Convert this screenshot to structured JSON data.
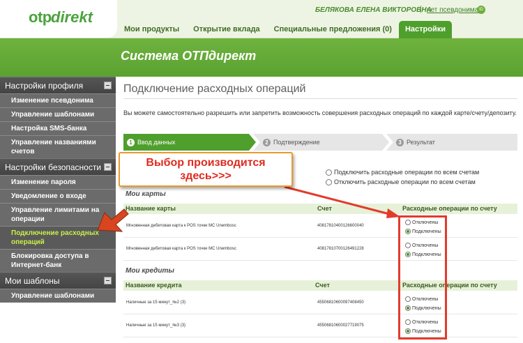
{
  "header": {
    "logo_otp": "otp",
    "logo_direkt": "direkt",
    "username": "БЕЛЯКОВА ЕЛЕНА ВИКТОРОВНА",
    "separator": "|",
    "alias_link": "нет псевдонима",
    "alias_icon": "ID"
  },
  "nav": {
    "tabs": [
      "Мои продукты",
      "Открытие вклада",
      "Специальные предложения (0)",
      "Настройки"
    ]
  },
  "banner": {
    "title": "Система ОТПдирект"
  },
  "sidebar": {
    "sections": [
      {
        "title": "Настройки профиля",
        "items": [
          "Изменение псевдонима",
          "Управление шаблонами",
          "Настройка SMS-банка",
          "Управление названиями счетов"
        ]
      },
      {
        "title": "Настройки безопасности",
        "items": [
          "Изменение пароля",
          "Уведомление о входе",
          "Управление лимитами на операции",
          "Подключение расходных операций",
          "Блокировка доступа в Интернет-банк"
        ]
      },
      {
        "title": "Мои шаблоны",
        "items": [
          "Управление шаблонами"
        ]
      }
    ]
  },
  "main": {
    "title": "Подключение расходных операций",
    "intro": "Вы можете самостоятельно разрешить или запретить возможность совершения расходных операций по каждой карте/счету/депозиту.",
    "steps": [
      {
        "num": "1",
        "label": "Ввод данных"
      },
      {
        "num": "2",
        "label": "Подтверждение"
      },
      {
        "num": "3",
        "label": "Результат"
      }
    ],
    "bulk": {
      "connect_all": "Подключить расходные операции по всем счетам",
      "disconnect_all": "Отключить расходные операции по всем счетам"
    },
    "cards": {
      "title": "Мои карты",
      "headers": [
        "Название карты",
        "Счет",
        "Расходные операции по счету"
      ],
      "rows": [
        {
          "name": "Мгновенная дебетовая карта к POS точке MC Unembosс",
          "account": "40817810400126600040",
          "off": "Отключены",
          "on": "Подключены"
        },
        {
          "name": "Мгновенная дебетовая карта к POS точке MC Unembosс",
          "account": "40817810700126491228",
          "off": "Отключены",
          "on": "Подключены"
        }
      ]
    },
    "credits": {
      "title": "Мои кредиты",
      "headers": [
        "Название кредита",
        "Счет",
        "Расходные операции по счету"
      ],
      "rows": [
        {
          "name": "Наличные за 15 минут_№2 (3)",
          "account": "45506810600097408450",
          "off": "Отключены",
          "on": "Подключены"
        },
        {
          "name": "Наличные за 15 минут_№3 (3)",
          "account": "45506810600027719075",
          "off": "Отключены",
          "on": "Подключены"
        }
      ]
    }
  },
  "annotation": {
    "callout": "Выбор производится\nздесь>>>",
    "colors": {
      "text": "#e02a1f",
      "border": "#e89a2c",
      "arrow": "#e23b2c"
    }
  }
}
